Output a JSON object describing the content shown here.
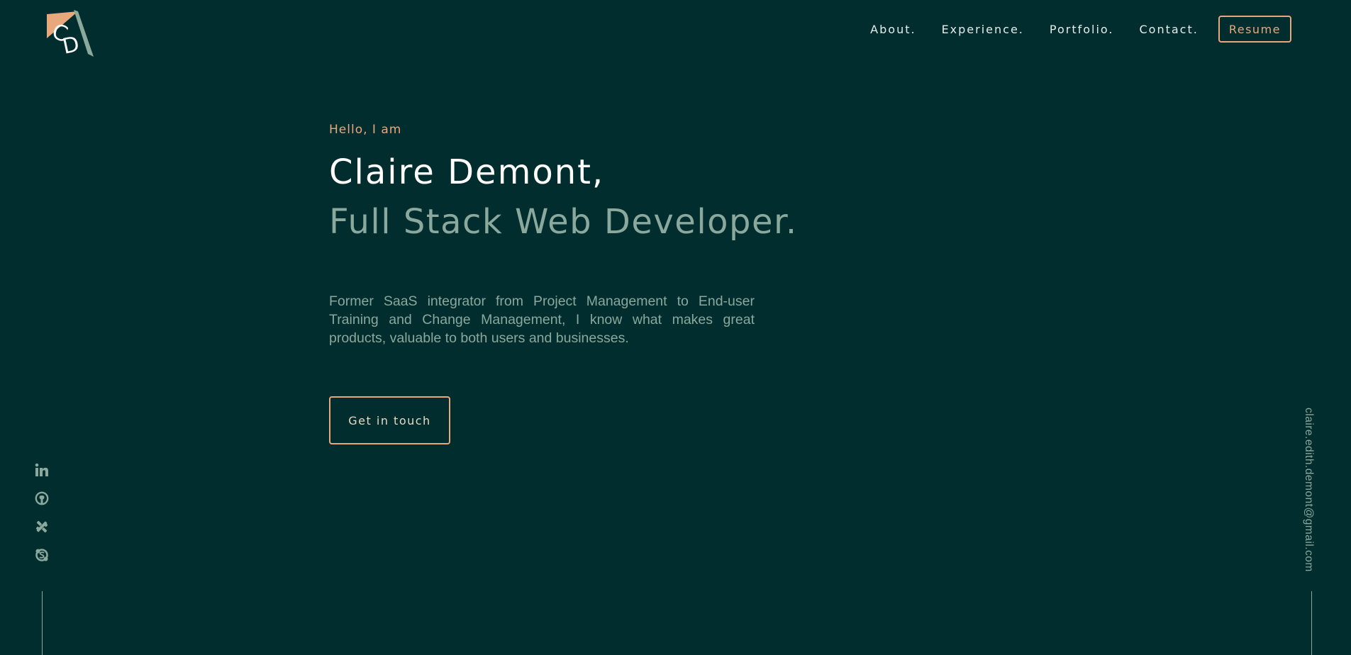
{
  "logo": {
    "letters": "CD",
    "accent_color": "#e8a87c",
    "secondary_color": "#8aa89c"
  },
  "nav": {
    "links": [
      "About.",
      "Experience.",
      "Portfolio.",
      "Contact."
    ],
    "resume_label": "Resume"
  },
  "hero": {
    "greeting": "Hello, I am",
    "name": "Claire Demont,",
    "role": "Full Stack Web Developer.",
    "intro": "Former SaaS integrator from Project Management to End-user Training and Change Management, I know what makes great products, valuable to both users and businesses.",
    "cta_label": "Get in touch"
  },
  "social": {
    "icons": [
      "linkedin-icon",
      "github-icon",
      "kaggle-icon",
      "skype-icon"
    ]
  },
  "email": "claire.edith.demont@gmail.com",
  "colors": {
    "background": "#022d2e",
    "accent": "#e8a87c",
    "muted": "#8aa89c",
    "text": "#ffffff"
  }
}
